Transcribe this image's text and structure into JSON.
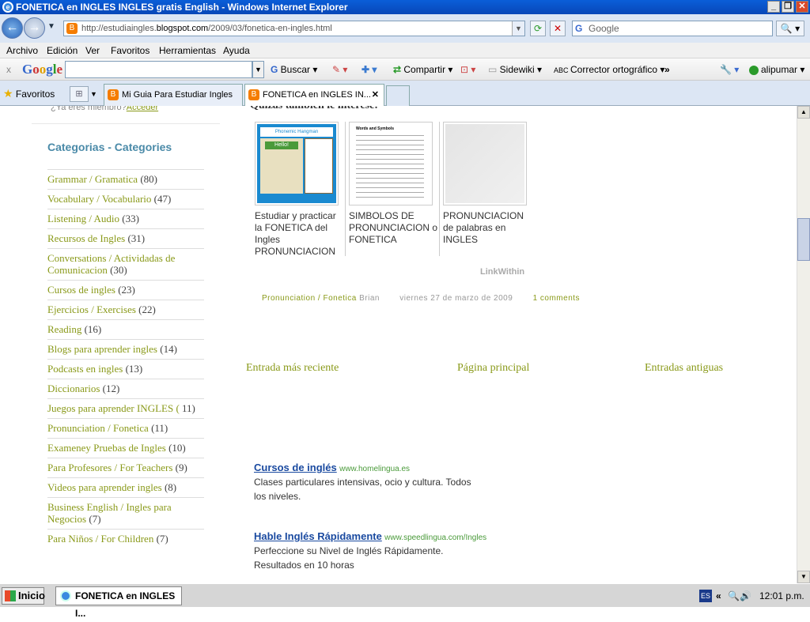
{
  "window": {
    "title": "FONETICA en INGLES INGLES gratis English - Windows Internet Explorer"
  },
  "address": {
    "prefix": "http://estudiaingles.",
    "domain": "blogspot.com",
    "path": "/2009/03/fonetica-en-ingles.html"
  },
  "search": {
    "placeholder": "Google"
  },
  "menu": [
    "Archivo",
    "Edición",
    "Ver",
    "Favoritos",
    "Herramientas",
    "Ayuda"
  ],
  "google_toolbar": {
    "buscar": "Buscar",
    "compartir": "Compartir",
    "sidewiki": "Sidewiki",
    "corrector": "Corrector ortográfico",
    "more": "»",
    "user": "alipumar"
  },
  "tabs": {
    "favoritos": "Favoritos",
    "tab1": "Mi Guia Para Estudiar Ingles",
    "tab2": "FONETICA en INGLES IN..."
  },
  "sidebar": {
    "member_text": "¿Ya eres miembro?",
    "member_link": "Acceder",
    "heading": "Categorias - Categories",
    "categories": [
      {
        "name": "Grammar / Gramatica",
        "count": "(80)"
      },
      {
        "name": "Vocabulary / Vocabulario",
        "count": "(47)"
      },
      {
        "name": "Listening / Audio",
        "count": "(33)"
      },
      {
        "name": "Recursos de Ingles",
        "count": "(31)"
      },
      {
        "name": "Conversations / Actividadas de Comunicacion",
        "count": "(30)"
      },
      {
        "name": "Cursos de ingles",
        "count": "(23)"
      },
      {
        "name": "Ejercicios / Exercises",
        "count": "(22)"
      },
      {
        "name": "Reading",
        "count": "(16)"
      },
      {
        "name": "Blogs para aprender ingles",
        "count": "(14)"
      },
      {
        "name": "Podcasts en ingles",
        "count": "(13)"
      },
      {
        "name": "Diccionarios",
        "count": "(12)"
      },
      {
        "name": "Juegos para aprender INGLES (",
        "count": "11)"
      },
      {
        "name": "Pronunciation / Fonetica",
        "count": "(11)"
      },
      {
        "name": "Exameney Pruebas de Ingles",
        "count": "(10)"
      },
      {
        "name": "Para Profesores / For Teachers",
        "count": "(9)"
      },
      {
        "name": "Videos para aprender ingles",
        "count": "(8)"
      },
      {
        "name": "Business English / Ingles para Negocios",
        "count": "(7)"
      },
      {
        "name": "Para Niños / For Children",
        "count": "(7)"
      }
    ]
  },
  "post": {
    "related_title": "Quizás también le interese:",
    "related": [
      "Estudiar y practicar la FONETICA del Ingles PRONUNCIACION",
      "SIMBOLOS DE PRONUNCIACION o FONETICA",
      "PRONUNCIACION de palabras en INGLES"
    ],
    "thumb1_title": "Phonemic Hangman",
    "thumb1_word": "Hello!",
    "thumb2_title": "Words and Symbols",
    "linkwithin": "LinkWithin",
    "footer": {
      "label": "Pronunciation / Fonetica",
      "author": "Brian",
      "date": "viernes 27 de marzo de 2009",
      "comments": "1 comments"
    },
    "pager": {
      "newer": "Entrada más reciente",
      "home": "Página principal",
      "older": "Entradas antiguas"
    }
  },
  "ads": [
    {
      "title": "Cursos de inglés",
      "url": "www.homelingua.es",
      "line1": "Clases particulares intensivas, ocio y cultura. Todos",
      "line2": "los niveles."
    },
    {
      "title": "Hable Inglés Rápidamente",
      "url": "www.speedlingua.com/Ingles",
      "line1": "Perfeccione su Nivel de Inglés Rápidamente.",
      "line2": "Resultados en 10 horas"
    }
  ],
  "taskbar": {
    "start": "Inicio",
    "task": "FONETICA en INGLES I...",
    "lang": "ES",
    "clock": "12:01 p.m."
  }
}
